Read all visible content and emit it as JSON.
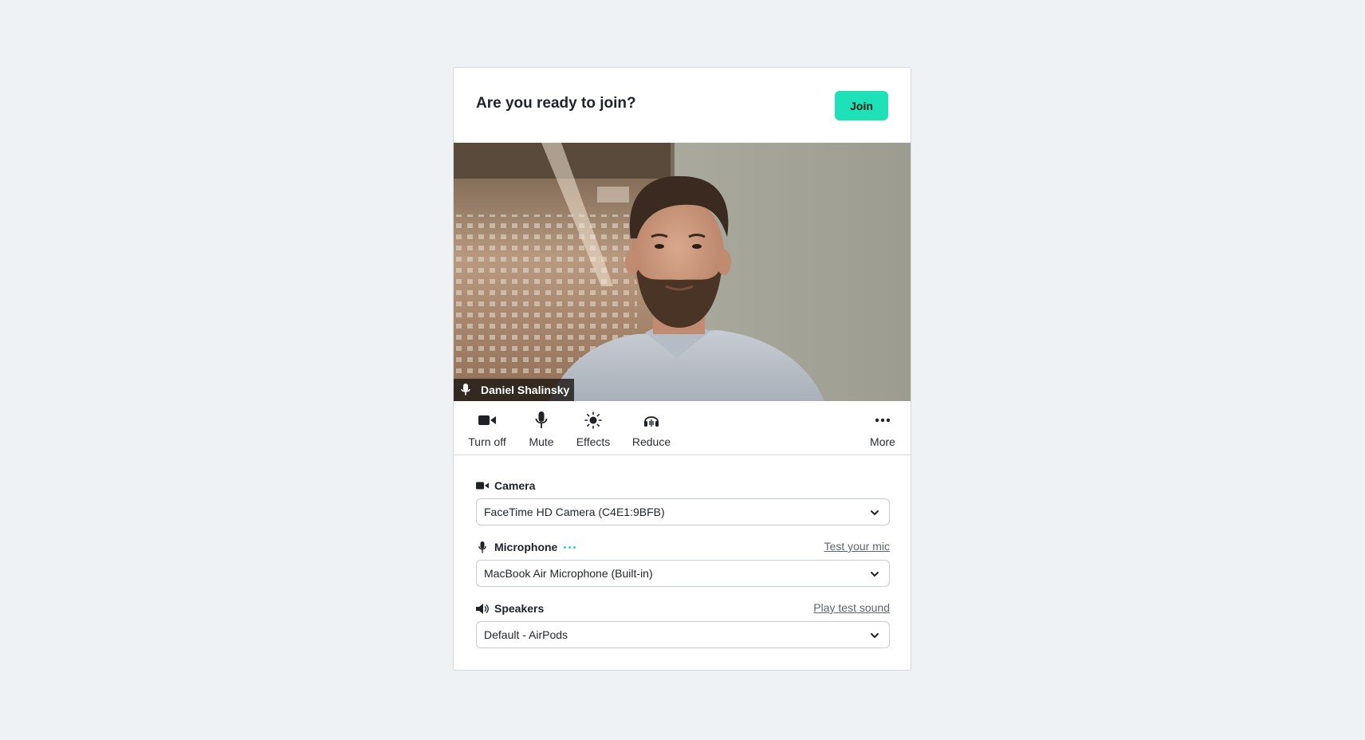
{
  "header": {
    "title": "Are you ready to join?",
    "join_label": "Join"
  },
  "video": {
    "participant_name": "Daniel Shalinsky"
  },
  "toolbar": {
    "items": [
      {
        "label": "Turn off",
        "icon": "video-camera-icon"
      },
      {
        "label": "Mute",
        "icon": "microphone-icon"
      },
      {
        "label": "Effects",
        "icon": "sparkle-icon"
      },
      {
        "label": "Reduce",
        "icon": "noise-reduce-icon"
      },
      {
        "label": "More",
        "icon": "more-dots-icon"
      }
    ]
  },
  "settings": {
    "camera": {
      "label": "Camera",
      "value": "FaceTime HD Camera (C4E1:9BFB)"
    },
    "microphone": {
      "label": "Microphone",
      "link": "Test your mic",
      "value": "MacBook Air Microphone (Built-in)"
    },
    "speakers": {
      "label": "Speakers",
      "link": "Play test sound",
      "value": "Default - AirPods"
    }
  },
  "colors": {
    "accent": "#1ee1b7",
    "background": "#eff2f5"
  }
}
